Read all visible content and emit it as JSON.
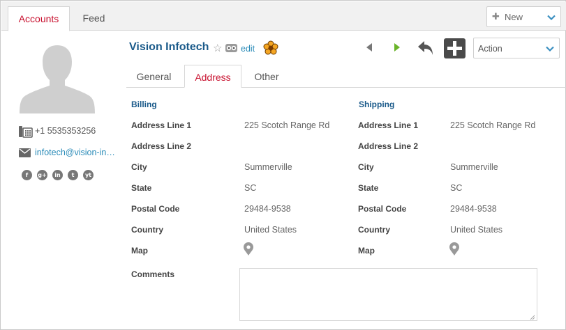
{
  "tabs": {
    "accounts": "Accounts",
    "feed": "Feed"
  },
  "new_button": {
    "label": "New"
  },
  "profile": {
    "phone": "+1 5535353256",
    "email": "infotech@vision-in…",
    "socials": [
      {
        "name": "facebook-icon",
        "glyph": "f"
      },
      {
        "name": "google-plus-icon",
        "glyph": "g+"
      },
      {
        "name": "linkedin-icon",
        "glyph": "in"
      },
      {
        "name": "twitter-icon",
        "glyph": "t"
      },
      {
        "name": "youtube-icon",
        "glyph": "yt"
      }
    ]
  },
  "header": {
    "title": "Vision Infotech",
    "edit_label": "edit"
  },
  "action_select": {
    "selected": "Action"
  },
  "subtabs": {
    "general": "General",
    "address": "Address",
    "other": "Other"
  },
  "address": {
    "billing": {
      "heading": "Billing",
      "labels": [
        "Address Line 1",
        "Address Line 2",
        "City",
        "State",
        "Postal Code",
        "Country",
        "Map"
      ],
      "values": [
        "225 Scotch Range Rd",
        "",
        "Summerville",
        "SC",
        "29484-9538",
        "United States",
        ""
      ]
    },
    "shipping": {
      "heading": "Shipping",
      "labels": [
        "Address Line 1",
        "Address Line 2",
        "City",
        "State",
        "Postal Code",
        "Country",
        "Map"
      ],
      "values": [
        "225 Scotch Range Rd",
        "",
        "Summerville",
        "SC",
        "29484-9538",
        "United States",
        ""
      ]
    },
    "comments_label": "Comments",
    "comments_value": ""
  },
  "colors": {
    "accent_red": "#c8102e",
    "title_blue": "#1a5a8a",
    "link_blue": "#2a8bb8",
    "next_green": "#6ab42a"
  }
}
